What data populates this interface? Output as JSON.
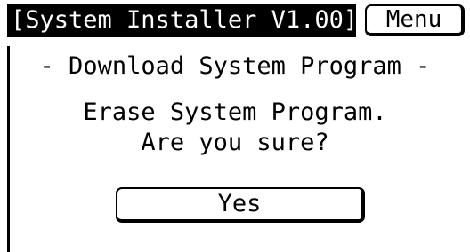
{
  "header": {
    "title": "[System Installer V1.00]",
    "menu_label": "Menu"
  },
  "main": {
    "subtitle": "- Download System Program -",
    "message_line1": "Erase System Program.",
    "message_line2": "Are you sure?",
    "yes_label": "Yes"
  },
  "colors": {
    "background": "#ffffff",
    "foreground": "#000000",
    "title_bar": "#000000",
    "title_text": "#ffffff"
  }
}
